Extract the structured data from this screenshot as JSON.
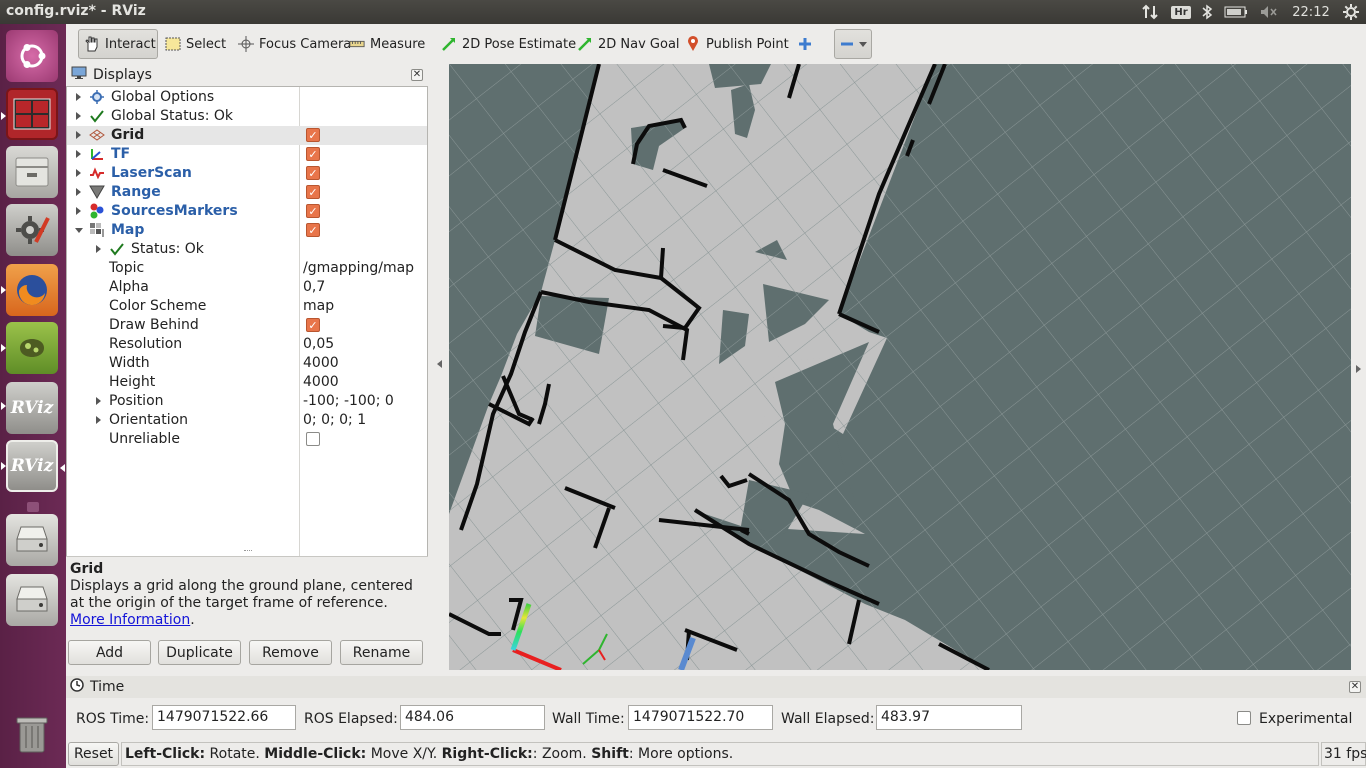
{
  "window": {
    "title": "config.rviz* - RViz"
  },
  "top_panel": {
    "keyboard_layout": "Hr",
    "clock": "22:12",
    "indicators": [
      "network-updown-icon",
      "keyboard-icon",
      "bluetooth-icon",
      "battery-icon",
      "volume-muted-icon",
      "gear-icon"
    ]
  },
  "launcher": {
    "items": [
      {
        "name": "ubuntu-dash",
        "icon": "ubuntu-logo-icon"
      },
      {
        "name": "terminal",
        "icon": "terminal-icon"
      },
      {
        "name": "files",
        "icon": "file-cabinet-icon"
      },
      {
        "name": "system-settings",
        "icon": "settings-icon"
      },
      {
        "name": "firefox",
        "icon": "firefox-icon"
      },
      {
        "name": "app-green",
        "icon": "green-app-icon"
      },
      {
        "name": "rviz-1",
        "label": "RViz"
      },
      {
        "name": "rviz-2",
        "label": "RViz"
      },
      {
        "name": "drive-1",
        "icon": "hard-drive-icon"
      },
      {
        "name": "drive-2",
        "icon": "hard-drive-icon"
      },
      {
        "name": "trash",
        "icon": "trash-icon"
      }
    ]
  },
  "toolbar": {
    "tools": [
      {
        "label": "Interact",
        "icon": "hand-icon",
        "active": true
      },
      {
        "label": "Select",
        "icon": "select-box-icon"
      },
      {
        "label": "Focus Camera",
        "icon": "crosshair-icon"
      },
      {
        "label": "Measure",
        "icon": "ruler-icon"
      },
      {
        "label": "2D Pose Estimate",
        "icon": "green-arrow-icon"
      },
      {
        "label": "2D Nav Goal",
        "icon": "green-arrow-icon"
      },
      {
        "label": "Publish Point",
        "icon": "pin-icon"
      }
    ]
  },
  "displays": {
    "title": "Displays",
    "rows": [
      {
        "label": "Global Options",
        "indent": 0,
        "expander": "right",
        "icon": "gear-icon"
      },
      {
        "label": "Global Status: Ok",
        "indent": 0,
        "expander": "right",
        "icon": "check-icon"
      },
      {
        "label": "Grid",
        "indent": 0,
        "expander": "right",
        "icon": "grid-icon",
        "checked": true,
        "style": "bold",
        "selected": true
      },
      {
        "label": "TF",
        "indent": 0,
        "expander": "right",
        "icon": "tf-icon",
        "checked": true,
        "style": "blue"
      },
      {
        "label": "LaserScan",
        "indent": 0,
        "expander": "right",
        "icon": "laser-icon",
        "checked": true,
        "style": "blue"
      },
      {
        "label": "Range",
        "indent": 0,
        "expander": "right",
        "icon": "range-icon",
        "checked": true,
        "style": "blue"
      },
      {
        "label": "SourcesMarkers",
        "indent": 0,
        "expander": "right",
        "icon": "markers-icon",
        "checked": true,
        "style": "blue"
      },
      {
        "label": "Map",
        "indent": 0,
        "expander": "down",
        "icon": "map-icon",
        "checked": true,
        "style": "blue"
      },
      {
        "label": "Status: Ok",
        "indent": 1,
        "expander": "right",
        "icon": "check-icon"
      },
      {
        "label": "Topic",
        "indent": 2,
        "value": "/gmapping/map"
      },
      {
        "label": "Alpha",
        "indent": 2,
        "value": "0,7"
      },
      {
        "label": "Color Scheme",
        "indent": 2,
        "value": "map"
      },
      {
        "label": "Draw Behind",
        "indent": 2,
        "checked": true
      },
      {
        "label": "Resolution",
        "indent": 2,
        "value": "0,05"
      },
      {
        "label": "Width",
        "indent": 2,
        "value": "4000"
      },
      {
        "label": "Height",
        "indent": 2,
        "value": "4000"
      },
      {
        "label": "Position",
        "indent": 2,
        "expander": "right",
        "value": "-100; -100; 0"
      },
      {
        "label": "Orientation",
        "indent": 2,
        "expander": "right",
        "value": "0; 0; 0; 1"
      },
      {
        "label": "Unreliable",
        "indent": 2,
        "checked": false
      }
    ],
    "description": {
      "title": "Grid",
      "text": "Displays a grid along the ground plane, centered at the origin of the target frame of reference.",
      "link": "More Information",
      "tail": "."
    },
    "buttons": {
      "add": "Add",
      "duplicate": "Duplicate",
      "remove": "Remove",
      "rename": "Rename"
    }
  },
  "time": {
    "title": "Time",
    "ros_time_label": "ROS Time:",
    "ros_time": "1479071522.66",
    "ros_elapsed_label": "ROS Elapsed:",
    "ros_elapsed": "484.06",
    "wall_time_label": "Wall Time:",
    "wall_time": "1479071522.70",
    "wall_elapsed_label": "Wall Elapsed:",
    "wall_elapsed": "483.97",
    "experimental_label": "Experimental",
    "experimental_checked": false
  },
  "status": {
    "reset_label": "Reset",
    "hint": [
      {
        "b": "Left-Click:",
        "t": " Rotate. "
      },
      {
        "b": "Middle-Click:",
        "t": " Move X/Y. "
      },
      {
        "b": "Right-Click:",
        "t": ": Zoom. "
      },
      {
        "b": "Shift",
        "t": ": More options."
      }
    ],
    "fps": "31 fps"
  },
  "colors": {
    "map_free": "#c1c1c1",
    "map_unknown": "#5f6f6f",
    "map_wall": "#0c0c0c",
    "accent_check": "#e8754a",
    "blue_label": "#2b5fa8"
  }
}
